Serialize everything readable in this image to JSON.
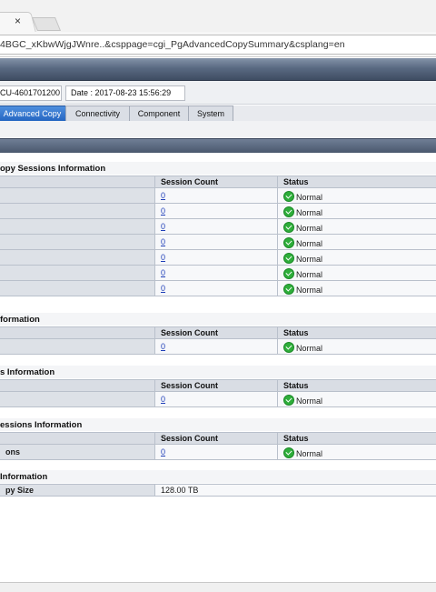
{
  "browser": {
    "tab_close": "×",
    "url": "4BGC_xKbwWjgJWnre..&csppage=cgi_PgAdvancedCopySummary&csplang=en"
  },
  "header": {
    "serial": "CU-4601701200",
    "date": "Date : 2017-08-23 15:56:29"
  },
  "menu": [
    {
      "label": "Advanced Copy",
      "active": true
    },
    {
      "label": "Connectivity",
      "active": false
    },
    {
      "label": "Component",
      "active": false
    },
    {
      "label": "System",
      "active": false
    }
  ],
  "columns": {
    "count": "Session Count",
    "status": "Status"
  },
  "status_color": "#2eae3a",
  "sections": {
    "copy_sessions": {
      "title": "opy Sessions Information",
      "rows": [
        {
          "label": "",
          "count": "0",
          "status": "Normal"
        },
        {
          "label": "",
          "count": "0",
          "status": "Normal"
        },
        {
          "label": "",
          "count": "0",
          "status": "Normal"
        },
        {
          "label": "",
          "count": "0",
          "status": "Normal"
        },
        {
          "label": "",
          "count": "0",
          "status": "Normal"
        },
        {
          "label": "",
          "count": "0",
          "status": "Normal"
        },
        {
          "label": "",
          "count": "0",
          "status": "Normal"
        }
      ]
    },
    "info2": {
      "title": "formation",
      "rows": [
        {
          "label": "",
          "count": "0",
          "status": "Normal"
        }
      ]
    },
    "info3": {
      "title": "s Information",
      "rows": [
        {
          "label": "",
          "count": "0",
          "status": "Normal"
        }
      ]
    },
    "info4": {
      "title": "essions Information",
      "rows": [
        {
          "label": "ons",
          "count": "0",
          "status": "Normal"
        }
      ]
    },
    "info5": {
      "title": "Information",
      "rows": [
        {
          "label": "py Size",
          "value": "128.00 TB"
        }
      ]
    }
  }
}
